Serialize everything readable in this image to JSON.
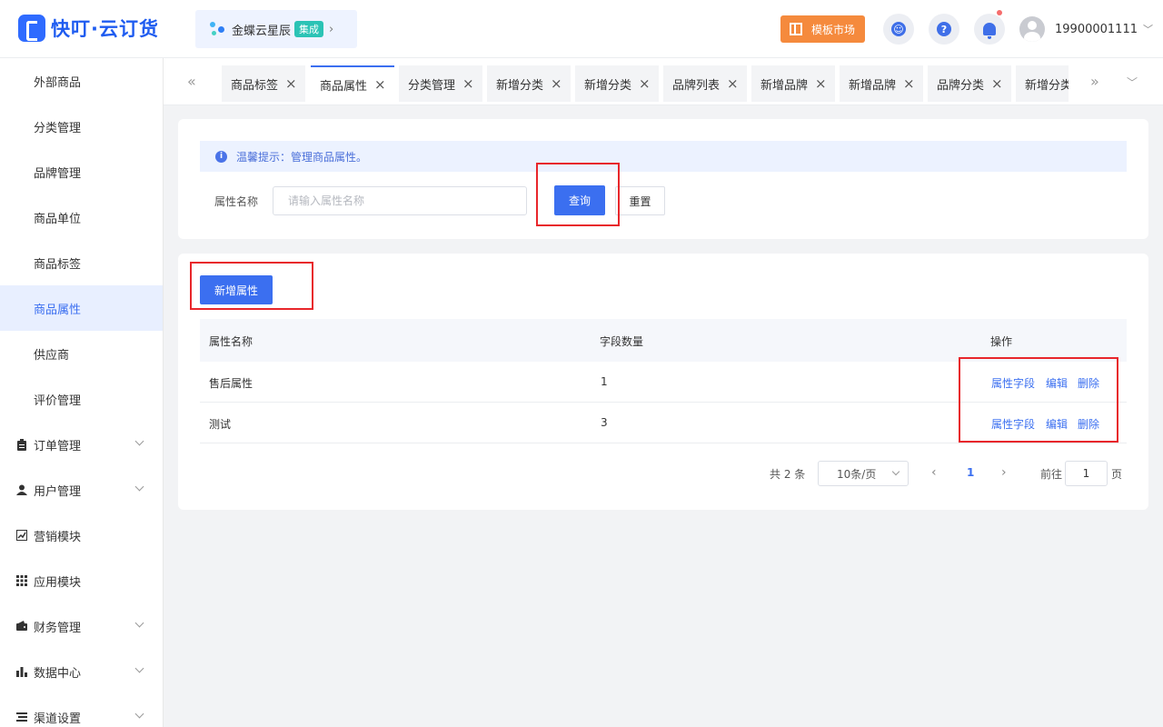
{
  "header": {
    "logo_text": "快叮·云订货",
    "org_name": "金蝶云星辰",
    "org_badge": "集成",
    "market_label": "模板市场",
    "username": "19900001111"
  },
  "sidebar": {
    "items": [
      {
        "label": "外部商品"
      },
      {
        "label": "分类管理"
      },
      {
        "label": "品牌管理"
      },
      {
        "label": "商品单位"
      },
      {
        "label": "商品标签"
      },
      {
        "label": "商品属性",
        "active": true
      },
      {
        "label": "供应商"
      },
      {
        "label": "评价管理"
      }
    ],
    "groups": [
      {
        "label": "订单管理",
        "icon": "clipboard-icon",
        "has_chevron": true
      },
      {
        "label": "用户管理",
        "icon": "user-icon",
        "has_chevron": true
      },
      {
        "label": "营销模块",
        "icon": "trend-chart-icon",
        "has_chevron": false
      },
      {
        "label": "应用模块",
        "icon": "grid-icon",
        "has_chevron": false
      },
      {
        "label": "财务管理",
        "icon": "wallet-icon",
        "has_chevron": true
      },
      {
        "label": "数据中心",
        "icon": "bar-chart-icon",
        "has_chevron": true
      },
      {
        "label": "渠道设置",
        "icon": "list-icon",
        "has_chevron": true
      }
    ]
  },
  "tabs": [
    {
      "label": "商品标签"
    },
    {
      "label": "商品属性",
      "active": true
    },
    {
      "label": "分类管理"
    },
    {
      "label": "新增分类"
    },
    {
      "label": "新增分类"
    },
    {
      "label": "品牌列表"
    },
    {
      "label": "新增品牌"
    },
    {
      "label": "新增品牌"
    },
    {
      "label": "品牌分类"
    },
    {
      "label": "新增分类"
    }
  ],
  "search": {
    "tip": "温馨提示：管理商品属性。",
    "field_label": "属性名称",
    "placeholder": "请输入属性名称",
    "query_label": "查询",
    "reset_label": "重置"
  },
  "table": {
    "add_label": "新增属性",
    "columns": [
      "属性名称",
      "字段数量",
      "操作"
    ],
    "rows": [
      {
        "name": "售后属性",
        "count": "1",
        "actions": [
          "属性字段",
          "编辑",
          "删除"
        ]
      },
      {
        "name": "测试",
        "count": "3",
        "actions": [
          "属性字段",
          "编辑",
          "删除"
        ]
      }
    ]
  },
  "pagination": {
    "total": "共 2 条",
    "page_size": "10条/页",
    "current": "1",
    "goto_prefix": "前往",
    "goto_value": "1",
    "goto_suffix": "页"
  },
  "colors": {
    "primary": "#3b6ff0",
    "annotation": "#e8262b",
    "market": "#f58a3d"
  }
}
